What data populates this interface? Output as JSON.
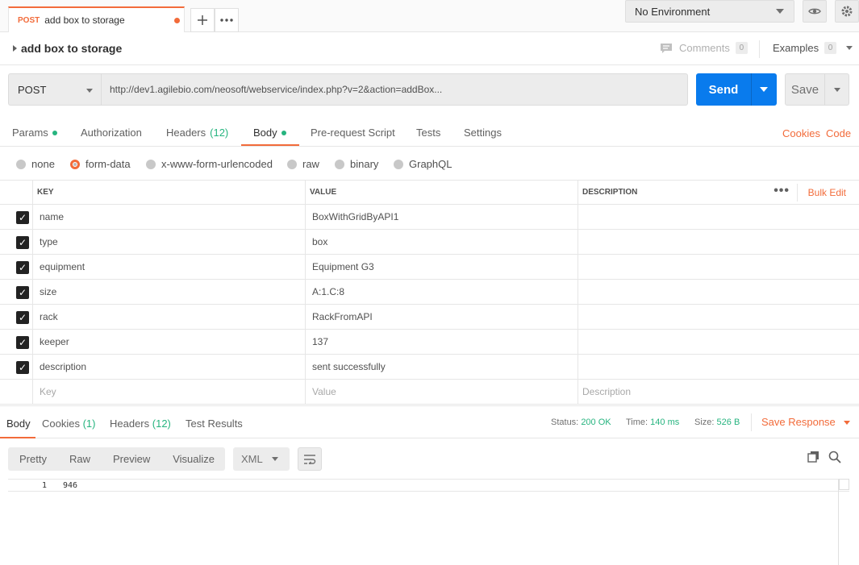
{
  "tab": {
    "method": "POST",
    "name": "add box to storage"
  },
  "environment": {
    "selected": "No Environment"
  },
  "request": {
    "title": "add box to storage",
    "comments_label": "Comments",
    "comments_count": "0",
    "examples_label": "Examples",
    "examples_count": "0",
    "method": "POST",
    "url": "http://dev1.agilebio.com/neosoft/webservice/index.php?v=2&action=addBox...",
    "send_label": "Send",
    "save_label": "Save"
  },
  "request_tabs": {
    "params": "Params",
    "authorization": "Authorization",
    "headers": "Headers",
    "headers_count": "(12)",
    "body": "Body",
    "prerequest": "Pre-request Script",
    "tests": "Tests",
    "settings": "Settings",
    "cookies": "Cookies",
    "code": "Code"
  },
  "body_types": [
    "none",
    "form-data",
    "x-www-form-urlencoded",
    "raw",
    "binary",
    "GraphQL"
  ],
  "body_type_selected": "form-data",
  "table": {
    "headers": {
      "key": "KEY",
      "value": "VALUE",
      "description": "DESCRIPTION",
      "bulk_edit": "Bulk Edit"
    },
    "rows": [
      {
        "key": "name",
        "value": "BoxWithGridByAPI1",
        "checked": true
      },
      {
        "key": "type",
        "value": "box",
        "checked": true
      },
      {
        "key": "equipment",
        "value": "Equipment G3",
        "checked": true
      },
      {
        "key": "size",
        "value": "A:1.C:8",
        "checked": true
      },
      {
        "key": "rack",
        "value": "RackFromAPI",
        "checked": true
      },
      {
        "key": "keeper",
        "value": "137",
        "checked": true
      },
      {
        "key": "description",
        "value": "sent successfully",
        "checked": true
      }
    ],
    "placeholders": {
      "key": "Key",
      "value": "Value",
      "description": "Description"
    }
  },
  "response": {
    "tabs": {
      "body": "Body",
      "cookies": "Cookies",
      "cookies_count": "(1)",
      "headers": "Headers",
      "headers_count": "(12)",
      "test_results": "Test Results"
    },
    "status_label": "Status:",
    "status_value": "200 OK",
    "time_label": "Time:",
    "time_value": "140 ms",
    "size_label": "Size:",
    "size_value": "526 B",
    "save_response": "Save Response",
    "views": [
      "Pretty",
      "Raw",
      "Preview",
      "Visualize"
    ],
    "format": "XML",
    "line_number": "1",
    "body_text": "946"
  },
  "colors": {
    "accent": "#f26b3a",
    "send": "#097bed",
    "success": "#26b47f"
  }
}
